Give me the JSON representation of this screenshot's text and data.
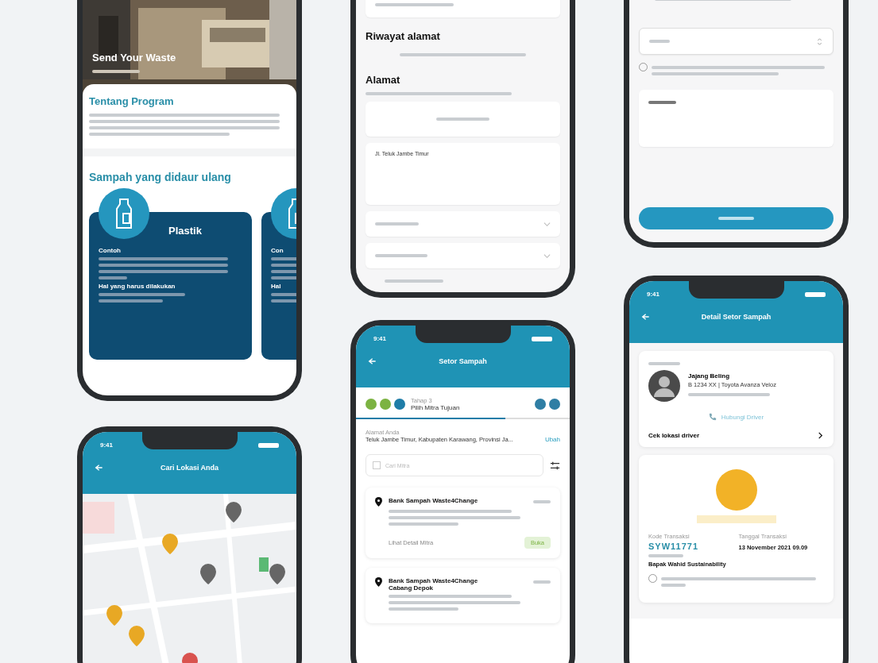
{
  "program_screen": {
    "hero_title": "Send Your Waste",
    "section_title": "Tentang Program",
    "recycle_title": "Sampah yang didaur ulang",
    "cards": [
      {
        "name": "Plastik",
        "example_label": "Contoh",
        "todo_label": "Hal yang harus dilakukan"
      },
      {
        "example_label": "Con",
        "todo_label": "Hal"
      }
    ]
  },
  "address_screen": {
    "history_title": "Riwayat alamat",
    "address_title": "Alamat",
    "address_value": "Jl. Teluk Jambe Timur"
  },
  "map_screen": {
    "time": "9:41",
    "title": "Cari Lokasi Anda"
  },
  "deposit_screen": {
    "time": "9:41",
    "title": "Setor Sampah",
    "steps": [
      {
        "done": true
      },
      {
        "done": true
      },
      {
        "done": false
      }
    ],
    "progress": {
      "level": 0.7
    },
    "step_label": "Tahap 3",
    "step_title": "Pilih Mitra Tujuan",
    "address_label": "Alamat Anda",
    "address": "Teluk Jambe Timur, Kabupaten Karawang, Provinsi Ja...",
    "change": "Ubah",
    "search_placeholder": "Cari Mitra",
    "partners": [
      {
        "name": "Bank Sampah Waste4Change",
        "link": "Lihat Detail Mitra",
        "status": "Buka"
      },
      {
        "name": "Bank Sampah Waste4Change Cabang Depok"
      }
    ]
  },
  "detail_screen": {
    "time": "9:41",
    "title": "Detail Setor Sampah",
    "driver_name": "Jajang Beling",
    "vehicle": "B 1234 XX  |  Toyota Avanza Veloz",
    "call": "Hubungi Driver",
    "locate": "Cek lokasi driver",
    "code_label": "Kode Transaksi",
    "code": "SYW11771",
    "date_label": "Tanggal Transaksi",
    "date": "13 November 2021 09.09",
    "recipient": "Bapak Wahid Sustainability"
  }
}
